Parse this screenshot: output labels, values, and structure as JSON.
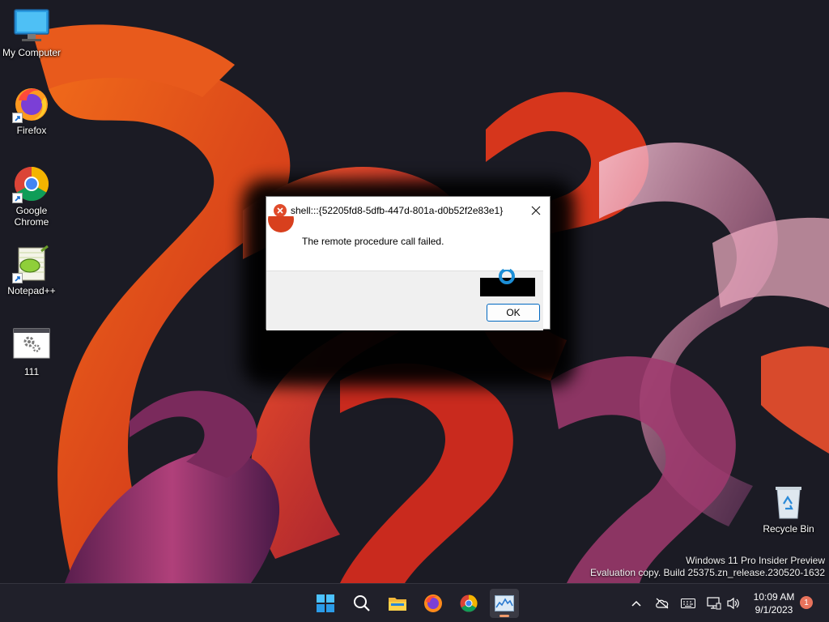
{
  "desktop": {
    "icons": [
      {
        "label": "My Computer",
        "icon": "monitor-icon"
      },
      {
        "label": "Firefox",
        "icon": "firefox-icon"
      },
      {
        "label": "Google Chrome",
        "icon": "chrome-icon"
      },
      {
        "label": "Notepad++",
        "icon": "notepad-plus-plus-icon"
      },
      {
        "label": "111",
        "icon": "settings-window-icon"
      },
      {
        "label": "Recycle Bin",
        "icon": "recycle-bin-icon"
      }
    ],
    "watermark": {
      "line1": "Windows 11 Pro Insider Preview",
      "line2": "Evaluation copy. Build 25375.zn_release.230520-1632"
    }
  },
  "dialog": {
    "title": "shell:::{52205fd8-5dfb-447d-801a-d0b52f2e83e1}",
    "message": "The remote procedure call failed.",
    "ok_label": "OK",
    "icon": "error-icon"
  },
  "taskbar": {
    "apps": [
      "start-icon",
      "search-icon",
      "file-explorer-icon",
      "firefox-icon",
      "chrome-icon",
      "task-manager-icon"
    ],
    "active_app": "task-manager-icon",
    "tray": [
      "chevron-up-icon",
      "onedrive-off-icon",
      "keyboard-icon",
      "network-icon",
      "volume-icon"
    ],
    "clock": {
      "time": "10:09 AM",
      "date": "9/1/2023"
    },
    "notification_count": "1"
  },
  "colors": {
    "taskbar_bg": "#20202a",
    "accent": "#0067c0",
    "error_red": "#e04b2b",
    "wallpaper_orange": "#e0521f"
  }
}
